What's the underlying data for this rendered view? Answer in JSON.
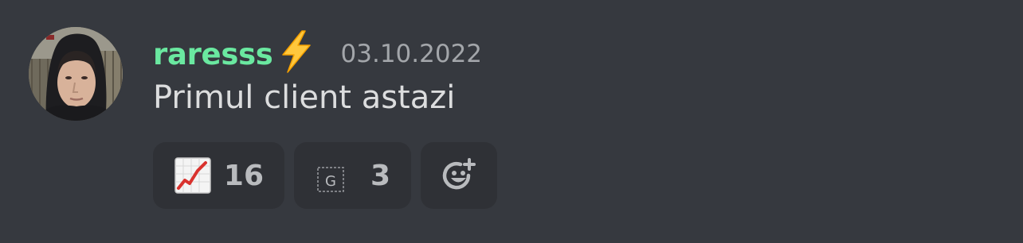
{
  "message": {
    "author": "raresss",
    "author_color": "#6ae8a0",
    "badge_icon": "high-voltage-icon",
    "timestamp": "03.10.2022",
    "content": "Primul client astazi"
  },
  "reactions": [
    {
      "emoji": "chart-increasing-icon",
      "count": "16"
    },
    {
      "emoji": "custom-emoji-placeholder-icon",
      "count": "3"
    }
  ],
  "add_reaction": {
    "icon": "add-reaction-icon"
  }
}
